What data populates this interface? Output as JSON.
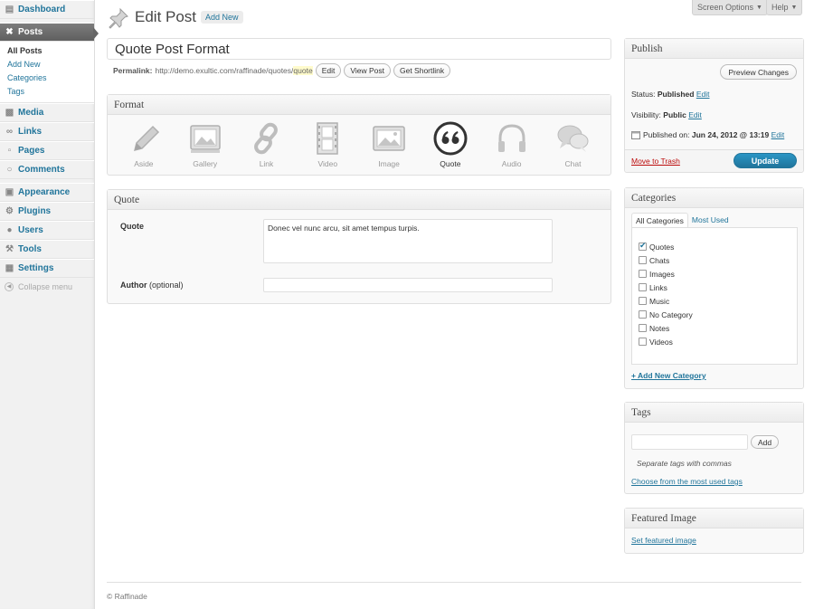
{
  "sidebar": {
    "items": [
      {
        "label": "Dashboard",
        "icon": "dashboard-icon"
      },
      {
        "label": "Posts",
        "icon": "pushpin-icon"
      },
      {
        "label": "Media",
        "icon": "media-icon"
      },
      {
        "label": "Links",
        "icon": "links-icon"
      },
      {
        "label": "Pages",
        "icon": "pages-icon"
      },
      {
        "label": "Comments",
        "icon": "comments-icon"
      },
      {
        "label": "Appearance",
        "icon": "appearance-icon"
      },
      {
        "label": "Plugins",
        "icon": "plugins-icon"
      },
      {
        "label": "Users",
        "icon": "users-icon"
      },
      {
        "label": "Tools",
        "icon": "tools-icon"
      },
      {
        "label": "Settings",
        "icon": "settings-icon"
      }
    ],
    "posts_submenu": [
      "All Posts",
      "Add New",
      "Categories",
      "Tags"
    ],
    "collapse_label": "Collapse menu"
  },
  "top": {
    "screen_options": "Screen Options",
    "help": "Help"
  },
  "header": {
    "title": "Edit Post",
    "add_new": "Add New"
  },
  "post": {
    "title": "Quote Post Format",
    "permalink_label": "Permalink:",
    "permalink_base": "http://demo.exultic.com/raffinade/quotes/",
    "permalink_slug": "quote",
    "edit_btn": "Edit",
    "view_btn": "View Post",
    "shortlink_btn": "Get Shortlink"
  },
  "format_box": {
    "title": "Format",
    "formats": [
      "Aside",
      "Gallery",
      "Link",
      "Video",
      "Image",
      "Quote",
      "Audio",
      "Chat"
    ],
    "selected": "Quote"
  },
  "quote_box": {
    "title": "Quote",
    "quote_label": "Quote",
    "quote_value": "Donec vel nunc arcu, sit amet tempus turpis.",
    "author_label": "Author",
    "author_optional": "(optional)",
    "author_value": ""
  },
  "publish": {
    "title": "Publish",
    "preview": "Preview Changes",
    "status_label": "Status:",
    "status_value": "Published",
    "visibility_label": "Visibility:",
    "visibility_value": "Public",
    "published_label": "Published on:",
    "published_value": "Jun 24, 2012 @ 13:19",
    "edit": "Edit",
    "trash": "Move to Trash",
    "update": "Update"
  },
  "categories": {
    "title": "Categories",
    "tab_all": "All Categories",
    "tab_used": "Most Used",
    "items": [
      {
        "label": "Quotes",
        "checked": true
      },
      {
        "label": "Chats",
        "checked": false
      },
      {
        "label": "Images",
        "checked": false
      },
      {
        "label": "Links",
        "checked": false
      },
      {
        "label": "Music",
        "checked": false
      },
      {
        "label": "No Category",
        "checked": false
      },
      {
        "label": "Notes",
        "checked": false
      },
      {
        "label": "Videos",
        "checked": false
      }
    ],
    "add_new": "+ Add New Category"
  },
  "tags": {
    "title": "Tags",
    "add": "Add",
    "hint": "Separate tags with commas",
    "choose": "Choose from the most used tags"
  },
  "featured": {
    "title": "Featured Image",
    "set_link": "Set featured image"
  },
  "footer": {
    "text": "© Raffinade"
  },
  "colors": {
    "link": "#21759b",
    "primary_button": "#21759b",
    "trash": "#bc0b0b",
    "active_menu": "#6d6d6d"
  }
}
